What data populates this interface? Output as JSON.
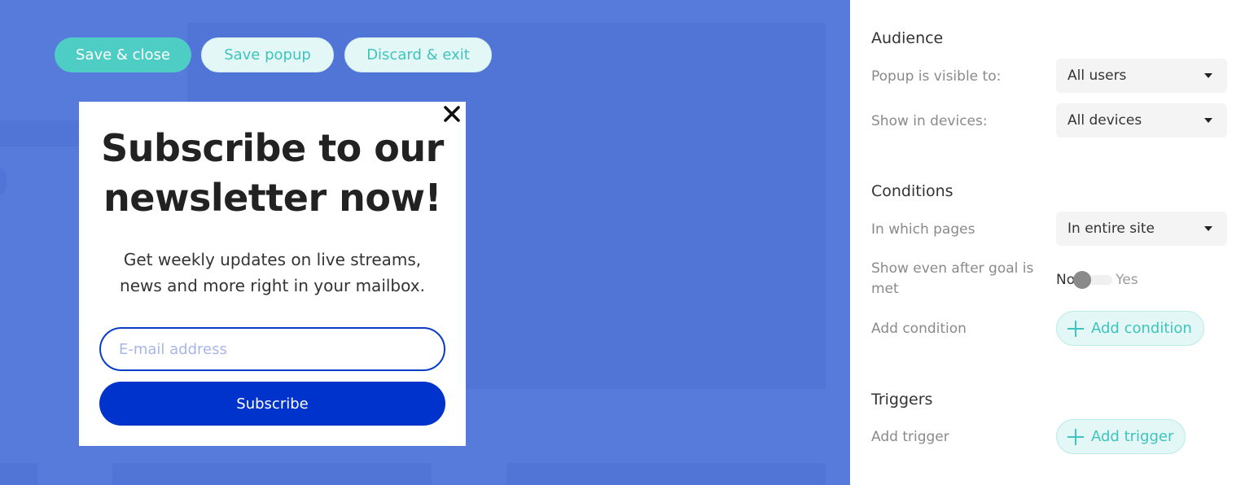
{
  "toolbar": {
    "save_close_label": "Save & close",
    "save_popup_label": "Save popup",
    "discard_exit_label": "Discard & exit"
  },
  "popup": {
    "title_line1": "Subscribe to our",
    "title_line2": "newsletter now!",
    "text_line1": "Get weekly updates on live streams,",
    "text_line2": "news and more right in your mailbox.",
    "email_placeholder": "E-mail address",
    "email_value": "",
    "subscribe_label": "Subscribe",
    "close_icon": "close-icon"
  },
  "audience": {
    "title": "Audience",
    "visible_label": "Popup is visible to:",
    "visible_value": "All users",
    "devices_label": "Show in devices:",
    "devices_value": "All devices"
  },
  "conditions": {
    "title": "Conditions",
    "pages_label": "In which pages",
    "pages_value": "In entire site",
    "goal_label": "Show even after goal is met",
    "toggle_no": "No",
    "toggle_yes": "Yes",
    "toggle_on": false,
    "add_condition_label": "Add condition",
    "add_condition_button": "Add condition"
  },
  "triggers": {
    "title": "Triggers",
    "add_trigger_label": "Add trigger",
    "add_trigger_button": "Add trigger"
  },
  "colors": {
    "canvas_bg": "#567bdb",
    "accent_teal": "#4ecdc4",
    "subscribe_blue": "#0033cc"
  }
}
